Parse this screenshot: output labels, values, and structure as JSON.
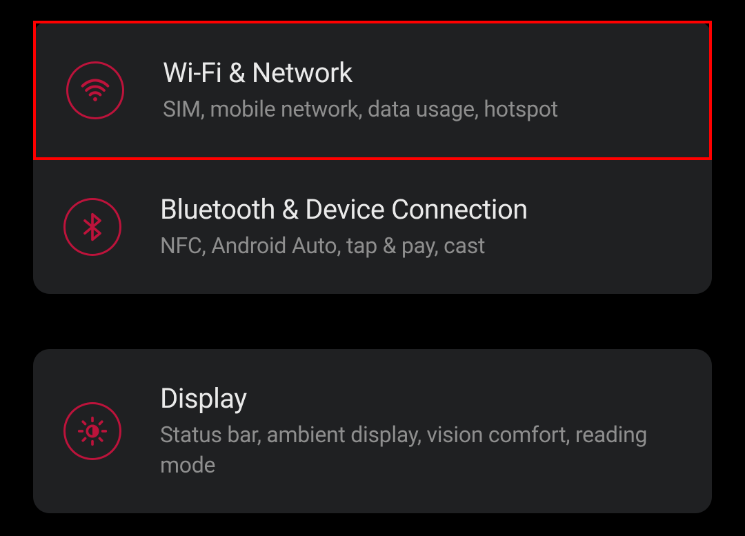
{
  "colors": {
    "accent": "#bc133b",
    "highlight": "#ff0000",
    "card_bg": "#1f2022",
    "page_bg": "#000000",
    "title": "#eaeaea",
    "subtitle": "#8e8e8e"
  },
  "groups": [
    {
      "items": [
        {
          "icon": "wifi",
          "title": "Wi-Fi & Network",
          "subtitle": "SIM, mobile network, data usage, hotspot",
          "highlighted": true
        },
        {
          "icon": "bluetooth",
          "title": "Bluetooth & Device Connection",
          "subtitle": "NFC, Android Auto, tap & pay, cast",
          "highlighted": false
        }
      ]
    },
    {
      "items": [
        {
          "icon": "display",
          "title": "Display",
          "subtitle": "Status bar, ambient display, vision comfort, reading mode",
          "highlighted": false
        }
      ]
    }
  ]
}
